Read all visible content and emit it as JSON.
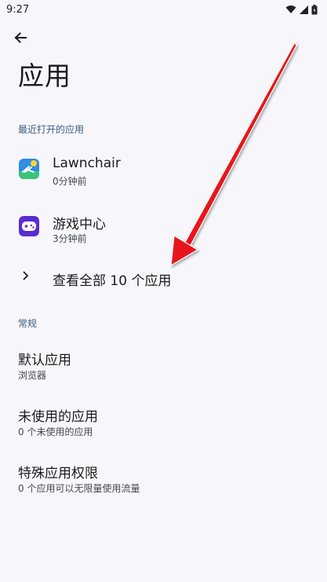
{
  "status_bar": {
    "time": "9:27",
    "icons": [
      "wifi-icon",
      "signal-icon",
      "battery-icon"
    ]
  },
  "toolbar": {
    "back_icon": "arrow-back-icon",
    "title": "应用"
  },
  "recent": {
    "header": "最近打开的应用",
    "apps": [
      {
        "name": "Lawnchair",
        "time": "0分钟前",
        "icon": "lawnchair-icon"
      },
      {
        "name": "游戏中心",
        "time": "3分钟前",
        "icon": "game-center-icon"
      }
    ],
    "see_all_label": "查看全部 10 个应用"
  },
  "general": {
    "header": "常规",
    "items": [
      {
        "title": "默认应用",
        "subtitle": "浏览器"
      },
      {
        "title": "未使用的应用",
        "subtitle": "0 个未使用的应用"
      },
      {
        "title": "特殊应用权限",
        "subtitle": "0 个应用可以无限量使用流量"
      }
    ]
  },
  "colors": {
    "background": "#f7f7fb",
    "section_header": "#3d5a80",
    "annotation_arrow": "#e8141b"
  }
}
